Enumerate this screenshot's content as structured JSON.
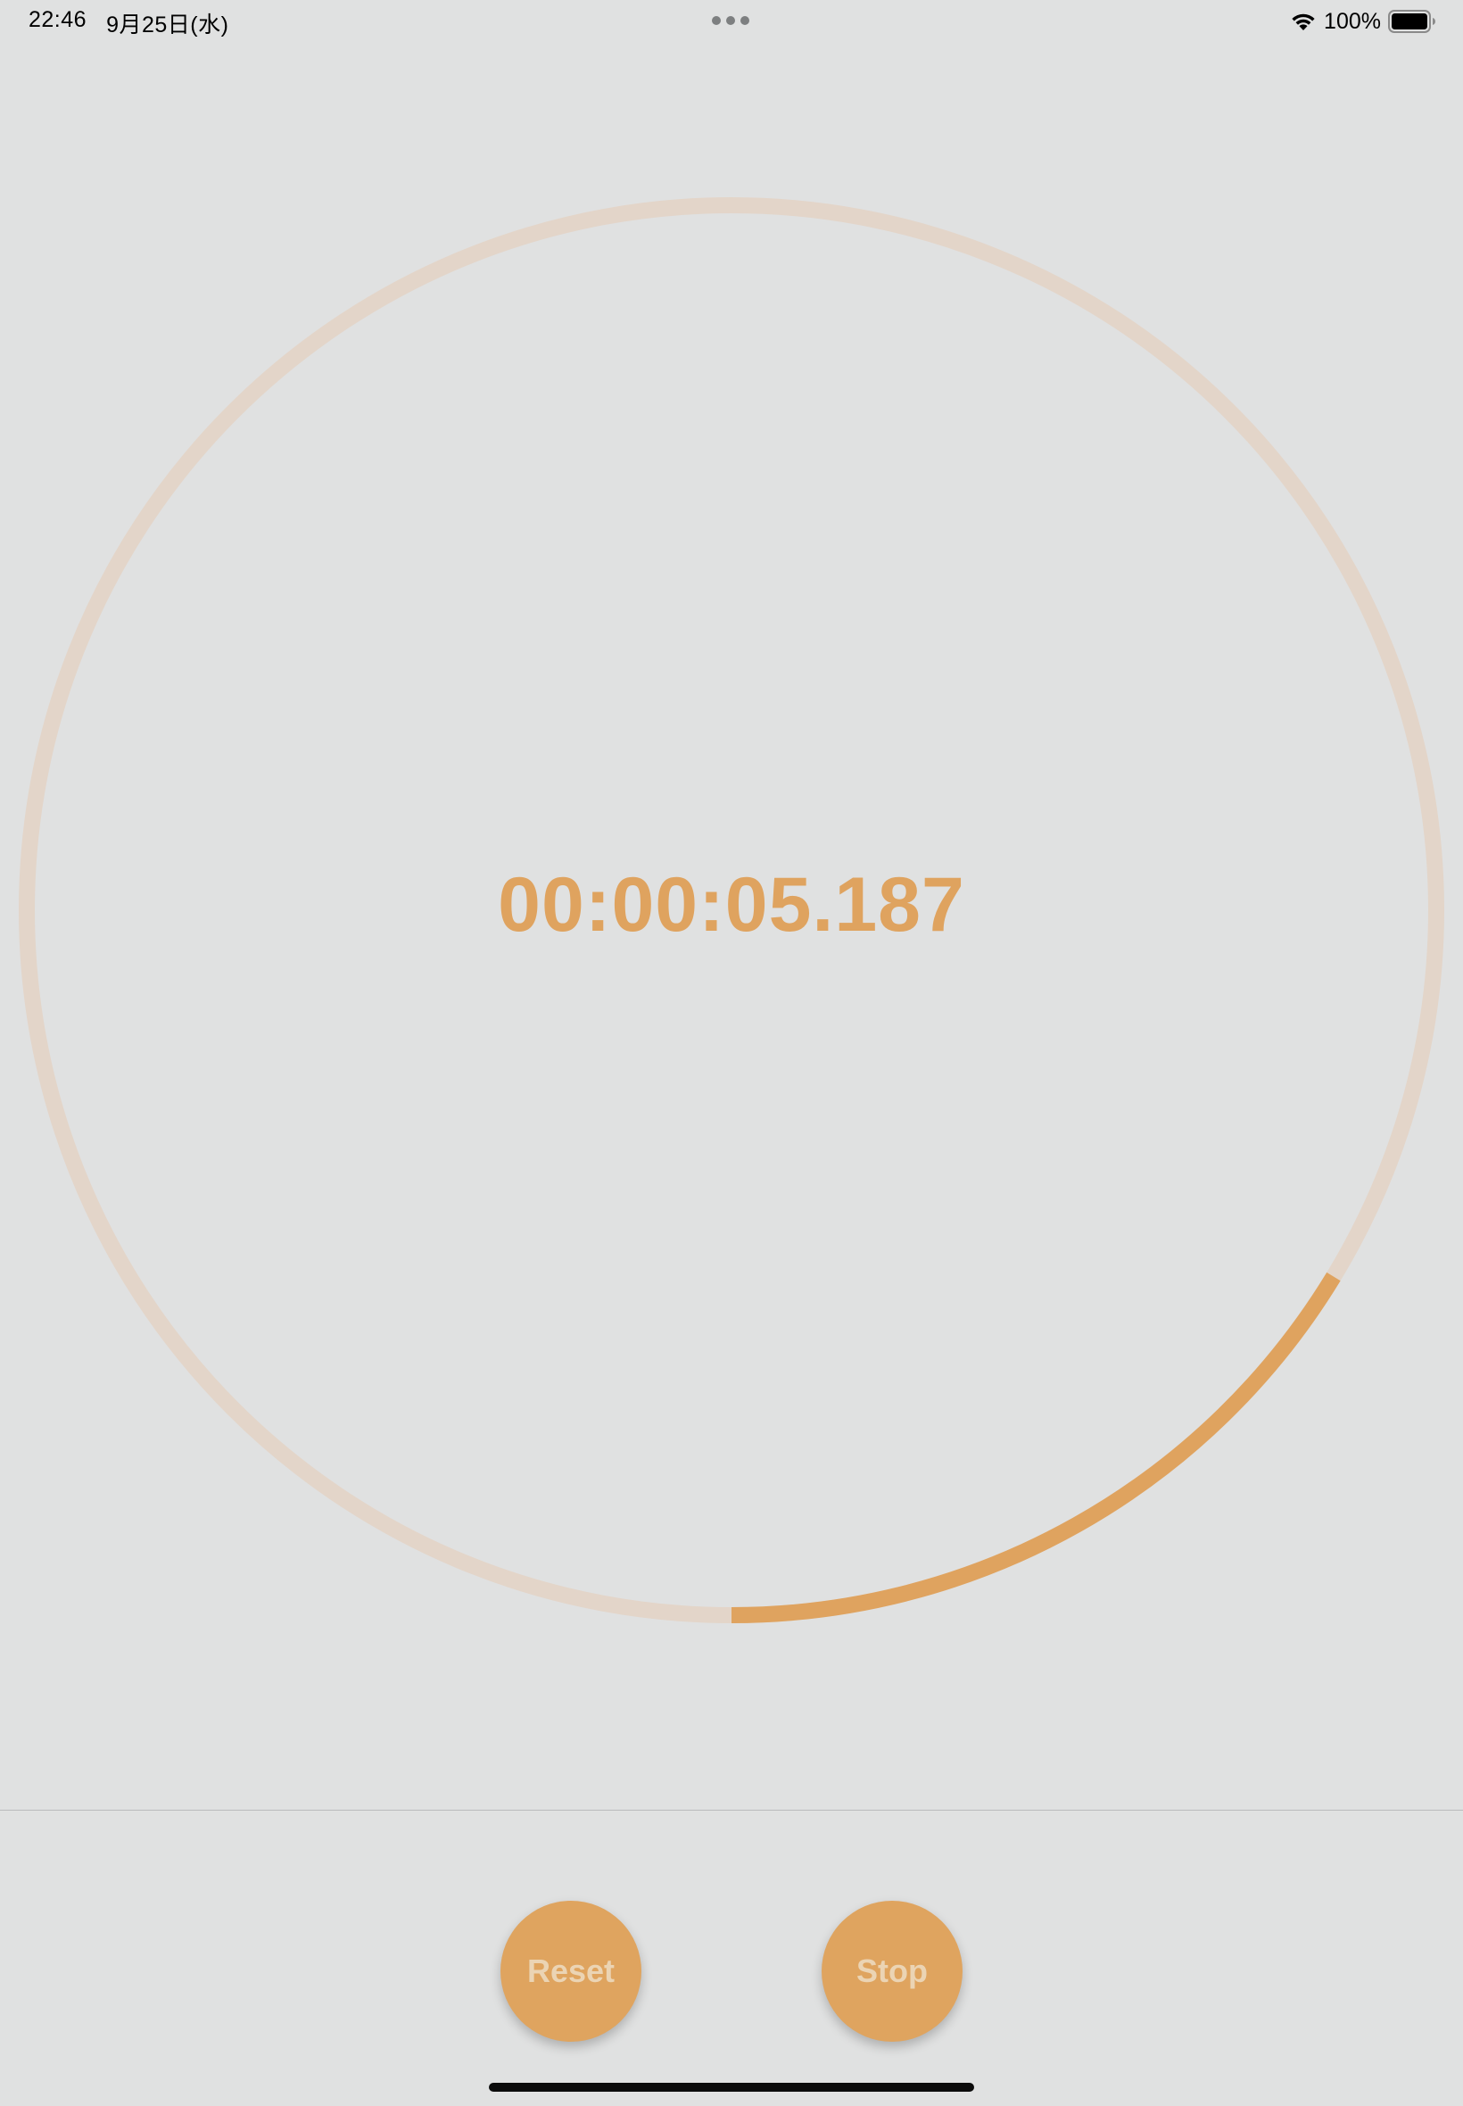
{
  "status_bar": {
    "time": "22:46",
    "date": "9月25日(水)",
    "battery_percent_label": "100%",
    "battery_level": 1.0,
    "icons": [
      "wifi-icon",
      "battery-icon",
      "multitasking-dots-icon"
    ]
  },
  "timer": {
    "elapsed": "00:00:05.187",
    "ring_progress_fraction": 0.163
  },
  "controls": {
    "reset_label": "Reset",
    "stop_label": "Stop"
  },
  "colors": {
    "background": "#e0e1e1",
    "accent": "#dfa35f",
    "ring_track": "#e3d5c9",
    "button_text": "#ebd4b4"
  }
}
